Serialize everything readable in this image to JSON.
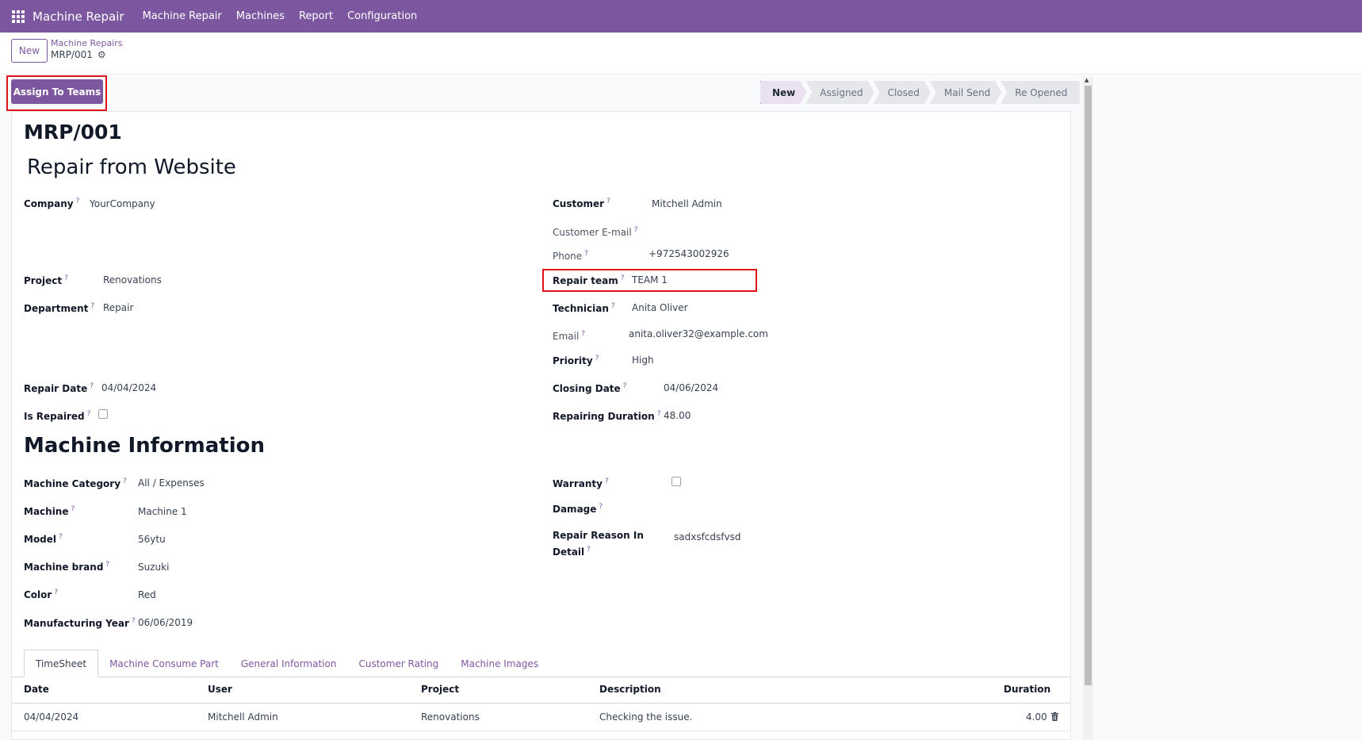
{
  "navbar": {
    "brand": "Machine Repair",
    "menu": [
      "Machine Repair",
      "Machines",
      "Report",
      "Configuration"
    ]
  },
  "control": {
    "new_label": "New",
    "breadcrumb_parent": "Machine Repairs",
    "breadcrumb_current": "MRP/001"
  },
  "actions": {
    "assign_label": "Assign To Teams"
  },
  "stages": [
    "New",
    "Assigned",
    "Closed",
    "Mail Send",
    "Re Opened"
  ],
  "active_stage": "New",
  "record": {
    "reference": "MRP/001",
    "name": "Repair from Website"
  },
  "labels": {
    "company": "Company",
    "project": "Project",
    "department": "Department",
    "repair_date": "Repair Date",
    "is_repaired": "Is Repaired",
    "customer": "Customer",
    "customer_email": "Customer E-mail",
    "phone": "Phone",
    "repair_team": "Repair team",
    "technician": "Technician",
    "email": "Email",
    "priority": "Priority",
    "closing_date": "Closing Date",
    "repairing_duration": "Repairing Duration",
    "machine_info": "Machine Information",
    "machine_category": "Machine Category",
    "machine": "Machine",
    "model": "Model",
    "machine_brand": "Machine brand",
    "color": "Color",
    "manufacturing_year": "Manufacturing Year",
    "warranty": "Warranty",
    "damage": "Damage",
    "repair_reason_1": "Repair Reason In",
    "repair_reason_2": "Detail",
    "help": "?"
  },
  "values": {
    "company": "YourCompany",
    "project": "Renovations",
    "department": "Repair",
    "repair_date": "04/04/2024",
    "is_repaired": false,
    "customer": "Mitchell Admin",
    "customer_email": "",
    "phone": "+972543002926",
    "repair_team": "TEAM 1",
    "technician": "Anita Oliver",
    "email": "anita.oliver32@example.com",
    "priority": "High",
    "closing_date": "04/06/2024",
    "repairing_duration": "48.00",
    "machine_category": "All / Expenses",
    "machine": "Machine 1",
    "model": "56ytu",
    "machine_brand": "Suzuki",
    "color": "Red",
    "manufacturing_year": "06/06/2019",
    "warranty": false,
    "damage": "",
    "repair_reason": "sadxsfcdsfvsd"
  },
  "tabs": [
    "TimeSheet",
    "Machine Consume Part",
    "General Information",
    "Customer Rating",
    "Machine Images"
  ],
  "active_tab": "TimeSheet",
  "timesheet": {
    "columns": [
      "Date",
      "User",
      "Project",
      "Description",
      "Duration"
    ],
    "rows": [
      {
        "date": "04/04/2024",
        "user": "Mitchell Admin",
        "project": "Renovations",
        "description": "Checking the issue.",
        "duration": "4.00"
      }
    ]
  },
  "colors": {
    "brand": "#7c579f",
    "highlight": "#e0131a"
  }
}
